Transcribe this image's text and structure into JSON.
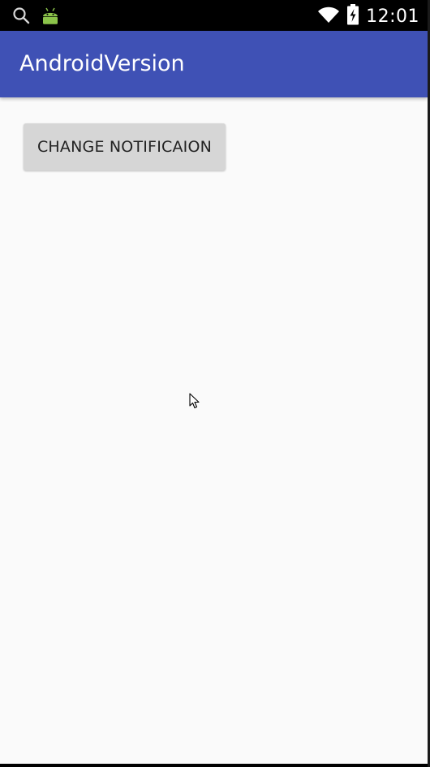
{
  "status_bar": {
    "time": "12:01",
    "icons": [
      "search-icon",
      "android-icon",
      "wifi-icon",
      "battery-charging-icon"
    ]
  },
  "app_bar": {
    "title": "AndroidVersion",
    "color": "#3f51b5"
  },
  "main": {
    "button_label": "CHANGE NOTIFICAION"
  }
}
